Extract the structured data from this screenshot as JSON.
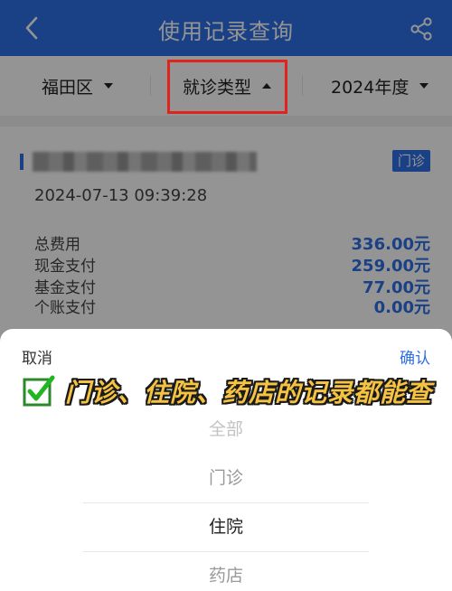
{
  "header": {
    "title": "使用记录查询",
    "back_icon": "chevron-left-icon",
    "share_icon": "share-icon",
    "color": "#2e6ee6"
  },
  "filters": {
    "district": "福田区",
    "visit_type": "就诊类型",
    "year": "2024年度"
  },
  "record": {
    "badge": "门诊",
    "datetime": "2024-07-13 09:39:28",
    "rows": [
      {
        "label": "总费用",
        "value": "336.00元"
      },
      {
        "label": "现金支付",
        "value": "259.00元"
      },
      {
        "label": "基金支付",
        "value": "77.00元"
      },
      {
        "label": "个账支付",
        "value": "0.00元"
      }
    ]
  },
  "picker": {
    "cancel": "取消",
    "confirm": "确认",
    "annotation": "门诊、住院、药店的记录都能查",
    "options": [
      "全部",
      "门诊",
      "住院",
      "药店"
    ],
    "selected": "住院"
  },
  "colors": {
    "accent": "#2e6ee6",
    "highlight_border": "#e0231e",
    "annotation_text": "#f5c242"
  }
}
